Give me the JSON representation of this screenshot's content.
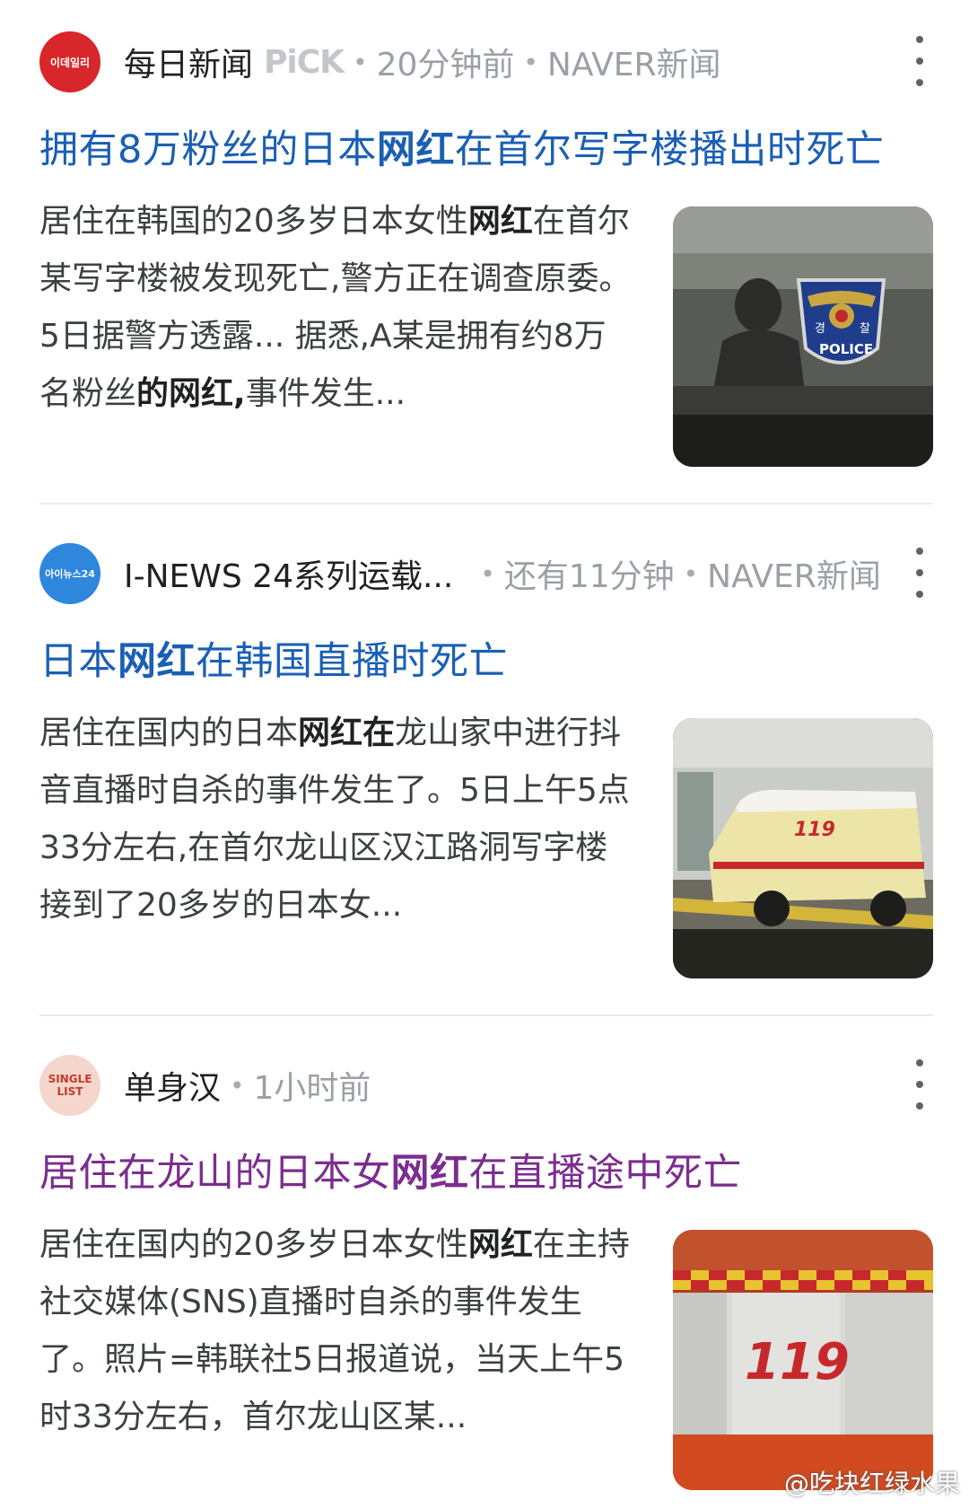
{
  "results": [
    {
      "source": "每日新闻",
      "pick": "PiCK",
      "dot": "•",
      "time": "20分钟前",
      "platform": "NAVER新闻",
      "logo_text": "이데일리",
      "title_parts": [
        "拥有8万粉丝的日本",
        "网红",
        "在首尔写字楼播出时死亡"
      ],
      "snippet_parts": [
        "居住在韩国的20多岁日本女性",
        "网红",
        "在首尔某写字楼被发现死亡,警方正在调查原委。5日据警方透露... 据悉,A某是拥有约8万名粉丝",
        "的网红,",
        "事件发生..."
      ],
      "thumb_text": "POLICE",
      "thumb_badge_left": "경",
      "thumb_badge_right": "찰"
    },
    {
      "source": "I-NEWS 24系列运载...",
      "dot": "•",
      "time": "还有11分钟",
      "platform": "NAVER新闻",
      "logo_text": "아이뉴스24",
      "title_parts": [
        "日本",
        "网红",
        "在韩国直播时死亡"
      ],
      "snippet_parts": [
        "居住在国内的日本",
        "网红在",
        "龙山家中进行抖音直播时自杀的事件发生了。5日上午5点33分左右,在首尔龙山区汉江路洞写字楼接到了20多岁的日本女..."
      ],
      "thumb_text": "119"
    },
    {
      "source": "单身汉",
      "dot": "•",
      "time": "1小时前",
      "logo_text": "SINGLE LIST",
      "title_parts": [
        "居住在龙山的日本女",
        "网红",
        "在直播途中死亡"
      ],
      "snippet_parts": [
        "居住在国内的20多岁日本女性",
        "网红",
        "在主持社交媒体(SNS)直播时自杀的事件发生了。照片=韩联社5日报道说，当天上午5时33分左右，首尔龙山区某..."
      ],
      "thumb_text": "119"
    }
  ],
  "watermark": "@吃块红绿水果",
  "colors": {
    "link_blue": "#1a5fb4",
    "link_visited": "#7b2d8e",
    "logo1": "#d8262b",
    "logo2": "#2f86dd"
  }
}
